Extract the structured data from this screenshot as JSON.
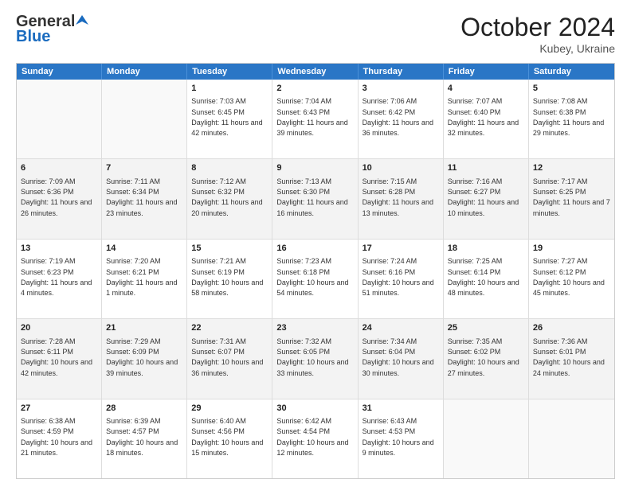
{
  "header": {
    "logo_general": "General",
    "logo_blue": "Blue",
    "month_title": "October 2024",
    "location": "Kubey, Ukraine"
  },
  "weekdays": [
    "Sunday",
    "Monday",
    "Tuesday",
    "Wednesday",
    "Thursday",
    "Friday",
    "Saturday"
  ],
  "rows": [
    [
      {
        "day": "",
        "sunrise": "",
        "sunset": "",
        "daylight": "",
        "empty": true
      },
      {
        "day": "",
        "sunrise": "",
        "sunset": "",
        "daylight": "",
        "empty": true
      },
      {
        "day": "1",
        "sunrise": "Sunrise: 7:03 AM",
        "sunset": "Sunset: 6:45 PM",
        "daylight": "Daylight: 11 hours and 42 minutes."
      },
      {
        "day": "2",
        "sunrise": "Sunrise: 7:04 AM",
        "sunset": "Sunset: 6:43 PM",
        "daylight": "Daylight: 11 hours and 39 minutes."
      },
      {
        "day": "3",
        "sunrise": "Sunrise: 7:06 AM",
        "sunset": "Sunset: 6:42 PM",
        "daylight": "Daylight: 11 hours and 36 minutes."
      },
      {
        "day": "4",
        "sunrise": "Sunrise: 7:07 AM",
        "sunset": "Sunset: 6:40 PM",
        "daylight": "Daylight: 11 hours and 32 minutes."
      },
      {
        "day": "5",
        "sunrise": "Sunrise: 7:08 AM",
        "sunset": "Sunset: 6:38 PM",
        "daylight": "Daylight: 11 hours and 29 minutes."
      }
    ],
    [
      {
        "day": "6",
        "sunrise": "Sunrise: 7:09 AM",
        "sunset": "Sunset: 6:36 PM",
        "daylight": "Daylight: 11 hours and 26 minutes."
      },
      {
        "day": "7",
        "sunrise": "Sunrise: 7:11 AM",
        "sunset": "Sunset: 6:34 PM",
        "daylight": "Daylight: 11 hours and 23 minutes."
      },
      {
        "day": "8",
        "sunrise": "Sunrise: 7:12 AM",
        "sunset": "Sunset: 6:32 PM",
        "daylight": "Daylight: 11 hours and 20 minutes."
      },
      {
        "day": "9",
        "sunrise": "Sunrise: 7:13 AM",
        "sunset": "Sunset: 6:30 PM",
        "daylight": "Daylight: 11 hours and 16 minutes."
      },
      {
        "day": "10",
        "sunrise": "Sunrise: 7:15 AM",
        "sunset": "Sunset: 6:28 PM",
        "daylight": "Daylight: 11 hours and 13 minutes."
      },
      {
        "day": "11",
        "sunrise": "Sunrise: 7:16 AM",
        "sunset": "Sunset: 6:27 PM",
        "daylight": "Daylight: 11 hours and 10 minutes."
      },
      {
        "day": "12",
        "sunrise": "Sunrise: 7:17 AM",
        "sunset": "Sunset: 6:25 PM",
        "daylight": "Daylight: 11 hours and 7 minutes."
      }
    ],
    [
      {
        "day": "13",
        "sunrise": "Sunrise: 7:19 AM",
        "sunset": "Sunset: 6:23 PM",
        "daylight": "Daylight: 11 hours and 4 minutes."
      },
      {
        "day": "14",
        "sunrise": "Sunrise: 7:20 AM",
        "sunset": "Sunset: 6:21 PM",
        "daylight": "Daylight: 11 hours and 1 minute."
      },
      {
        "day": "15",
        "sunrise": "Sunrise: 7:21 AM",
        "sunset": "Sunset: 6:19 PM",
        "daylight": "Daylight: 10 hours and 58 minutes."
      },
      {
        "day": "16",
        "sunrise": "Sunrise: 7:23 AM",
        "sunset": "Sunset: 6:18 PM",
        "daylight": "Daylight: 10 hours and 54 minutes."
      },
      {
        "day": "17",
        "sunrise": "Sunrise: 7:24 AM",
        "sunset": "Sunset: 6:16 PM",
        "daylight": "Daylight: 10 hours and 51 minutes."
      },
      {
        "day": "18",
        "sunrise": "Sunrise: 7:25 AM",
        "sunset": "Sunset: 6:14 PM",
        "daylight": "Daylight: 10 hours and 48 minutes."
      },
      {
        "day": "19",
        "sunrise": "Sunrise: 7:27 AM",
        "sunset": "Sunset: 6:12 PM",
        "daylight": "Daylight: 10 hours and 45 minutes."
      }
    ],
    [
      {
        "day": "20",
        "sunrise": "Sunrise: 7:28 AM",
        "sunset": "Sunset: 6:11 PM",
        "daylight": "Daylight: 10 hours and 42 minutes."
      },
      {
        "day": "21",
        "sunrise": "Sunrise: 7:29 AM",
        "sunset": "Sunset: 6:09 PM",
        "daylight": "Daylight: 10 hours and 39 minutes."
      },
      {
        "day": "22",
        "sunrise": "Sunrise: 7:31 AM",
        "sunset": "Sunset: 6:07 PM",
        "daylight": "Daylight: 10 hours and 36 minutes."
      },
      {
        "day": "23",
        "sunrise": "Sunrise: 7:32 AM",
        "sunset": "Sunset: 6:05 PM",
        "daylight": "Daylight: 10 hours and 33 minutes."
      },
      {
        "day": "24",
        "sunrise": "Sunrise: 7:34 AM",
        "sunset": "Sunset: 6:04 PM",
        "daylight": "Daylight: 10 hours and 30 minutes."
      },
      {
        "day": "25",
        "sunrise": "Sunrise: 7:35 AM",
        "sunset": "Sunset: 6:02 PM",
        "daylight": "Daylight: 10 hours and 27 minutes."
      },
      {
        "day": "26",
        "sunrise": "Sunrise: 7:36 AM",
        "sunset": "Sunset: 6:01 PM",
        "daylight": "Daylight: 10 hours and 24 minutes."
      }
    ],
    [
      {
        "day": "27",
        "sunrise": "Sunrise: 6:38 AM",
        "sunset": "Sunset: 4:59 PM",
        "daylight": "Daylight: 10 hours and 21 minutes."
      },
      {
        "day": "28",
        "sunrise": "Sunrise: 6:39 AM",
        "sunset": "Sunset: 4:57 PM",
        "daylight": "Daylight: 10 hours and 18 minutes."
      },
      {
        "day": "29",
        "sunrise": "Sunrise: 6:40 AM",
        "sunset": "Sunset: 4:56 PM",
        "daylight": "Daylight: 10 hours and 15 minutes."
      },
      {
        "day": "30",
        "sunrise": "Sunrise: 6:42 AM",
        "sunset": "Sunset: 4:54 PM",
        "daylight": "Daylight: 10 hours and 12 minutes."
      },
      {
        "day": "31",
        "sunrise": "Sunrise: 6:43 AM",
        "sunset": "Sunset: 4:53 PM",
        "daylight": "Daylight: 10 hours and 9 minutes."
      },
      {
        "day": "",
        "sunrise": "",
        "sunset": "",
        "daylight": "",
        "empty": true
      },
      {
        "day": "",
        "sunrise": "",
        "sunset": "",
        "daylight": "",
        "empty": true
      }
    ]
  ]
}
